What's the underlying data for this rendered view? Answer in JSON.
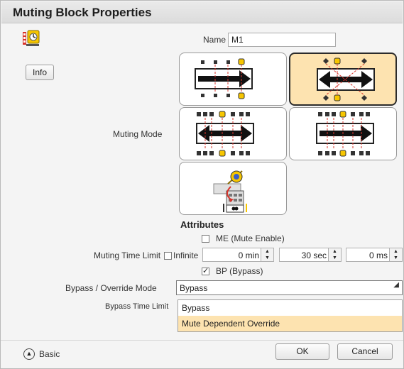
{
  "dialog": {
    "title": "Muting Block Properties"
  },
  "info_button": "Info",
  "name": {
    "label": "Name",
    "value": "M1"
  },
  "muting_mode": {
    "label": "Muting Mode",
    "modes": [
      "mode-1",
      "mode-2",
      "mode-3",
      "mode-4",
      "mode-5"
    ],
    "selected_index": 1
  },
  "attributes": {
    "heading": "Attributes",
    "me_label": "ME (Mute Enable)",
    "me_checked": false,
    "muting_time_limit_label": "Muting Time Limit",
    "infinite_label": "Infinite",
    "infinite_checked": false,
    "min_value": "0 min",
    "sec_value": "30 sec",
    "ms_value": "0 ms",
    "bp_label": "BP (Bypass)",
    "bp_checked": true,
    "bp_check_glyph": "✓"
  },
  "bypass": {
    "mode_label": "Bypass / Override Mode",
    "mode_value": "Bypass",
    "time_limit_label": "Bypass Time Limit",
    "options": [
      "Bypass",
      "Mute Dependent Override"
    ],
    "highlighted_index": 1
  },
  "footer": {
    "basic_label": "Basic",
    "basic_icon": "chevron-up-circle-icon",
    "ok_label": "OK",
    "cancel_label": "Cancel"
  },
  "colors": {
    "selected_fill": "#fde3b0",
    "sensor_yellow": "#f7c600",
    "beam_red": "#d9342b"
  }
}
